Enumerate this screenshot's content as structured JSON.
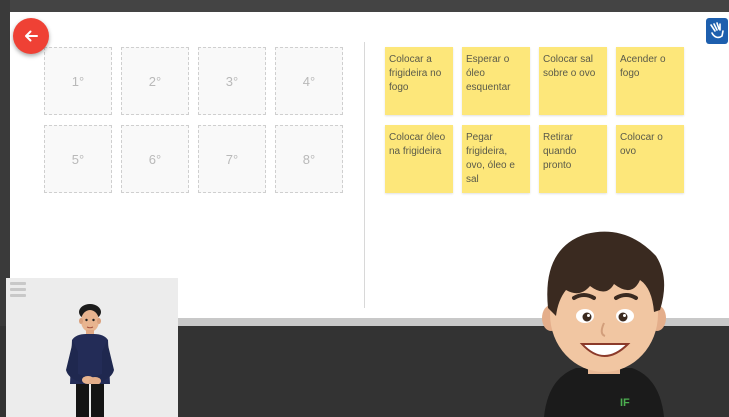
{
  "navigation": {
    "back_icon": "arrow-left-icon",
    "accessibility_icon": "sign-language-icon"
  },
  "slots": [
    {
      "label": "1°"
    },
    {
      "label": "2°"
    },
    {
      "label": "3°"
    },
    {
      "label": "4°"
    },
    {
      "label": "5°"
    },
    {
      "label": "6°"
    },
    {
      "label": "7°"
    },
    {
      "label": "8°"
    }
  ],
  "cards": [
    {
      "text": "Colocar a frigideira no fogo"
    },
    {
      "text": "Esperar o óleo esquentar"
    },
    {
      "text": "Colocar sal sobre o ovo"
    },
    {
      "text": "Acender o fogo"
    },
    {
      "text": "Colocar óleo na frigideira"
    },
    {
      "text": "Pegar frigideira, ovo, óleo e sal"
    },
    {
      "text": "Retirar quando pronto"
    },
    {
      "text": "Colocar o ovo"
    }
  ],
  "interpreter": {
    "menu_icon": "hamburger-menu-icon"
  },
  "character": {
    "shirt_logo": "IF"
  },
  "colors": {
    "card": "#fde77a",
    "back_button": "#ef4135",
    "accessibility_button": "#1d5fae"
  }
}
